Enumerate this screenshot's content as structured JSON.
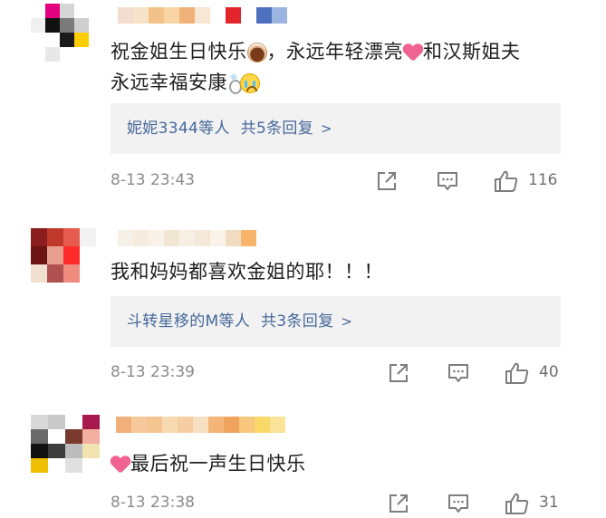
{
  "comments": [
    {
      "text_parts": [
        "祝金姐生日快乐",
        "，永远年轻漂亮",
        "和汉斯姐夫",
        "永远幸福安康"
      ],
      "emoji": [
        "cake-icon",
        "heart-icon",
        "ring-icon",
        "crying-face-icon"
      ],
      "replies": {
        "users": "妮妮3344等人",
        "count": "共5条回复",
        "chevron": ">"
      },
      "time": "8-13 23:43",
      "likes": "116",
      "avatar_colors": [
        "#ffffff",
        "#e3007f",
        "#d6d6d6",
        "#ffffff",
        "#f0f0f0",
        "#111111",
        "#7a7a7a",
        "#cfcfcf",
        "#ffffff",
        "#ffffff",
        "#1a1a1a",
        "#ffcc00",
        "#ffffff",
        "#e8e8e8",
        "#ffffff",
        "#ffffff"
      ],
      "name_colors": [
        "#f2ddd0",
        "#f6e3c9",
        "#f3c28a",
        "#f7d5a5",
        "#f1b27a",
        "#f8e7d3",
        "#ffffff",
        "#e3242b",
        "#ffffff",
        "#4f6fbf",
        "#9cb4e0"
      ]
    },
    {
      "text_parts": [
        "我和妈妈都喜欢金姐的耶！！！"
      ],
      "emoji": [],
      "replies": {
        "users": "斗转星移的M等人",
        "count": "共3条回复",
        "chevron": ">"
      },
      "time": "8-13 23:39",
      "likes": "40",
      "avatar_colors": [
        "#8b1e1e",
        "#c0392b",
        "#e55b4d",
        "#f2f2f2",
        "#6d1414",
        "#e7a08f",
        "#ff2a2a",
        "#ffffff",
        "#f1e0d0",
        "#b05050",
        "#f08b80",
        "#ffffff"
      ],
      "name_colors": [
        "#f6f1e8",
        "#f5ecdf",
        "#f8f2e9",
        "#f2e6d4",
        "#f7efe3",
        "#f4e8d8",
        "#f9f3ea",
        "#f1dcc2",
        "#f7b46b"
      ]
    },
    {
      "text_parts": [
        "最后祝一声生日快乐"
      ],
      "emoji": [
        "heart-icon"
      ],
      "replies": null,
      "time": "8-13 23:38",
      "likes": "31",
      "avatar_colors": [
        "#d9d9d9",
        "#c9c9c9",
        "#ffffff",
        "#a8184e",
        "#6a6a6a",
        "#ffffff",
        "#7a3b2e",
        "#f3b0a0",
        "#111111",
        "#3d3d3d",
        "#bcbcbc",
        "#f1e4b0",
        "#f0c000",
        "#ffffff",
        "#e0e0e0",
        "#ffffff"
      ],
      "name_colors": [
        "#f1b07a",
        "#f6c99a",
        "#f4c491",
        "#f7d9b2",
        "#f5cfa3",
        "#f8e0c2",
        "#f3b678",
        "#f0a35c",
        "#f7c77e",
        "#f9d96a",
        "#fbe39a"
      ]
    }
  ],
  "colors": {
    "link": "#45689b",
    "reply_bg": "#f2f2f2",
    "meta": "#8a8a8a",
    "icon": "#7d7d7d"
  }
}
